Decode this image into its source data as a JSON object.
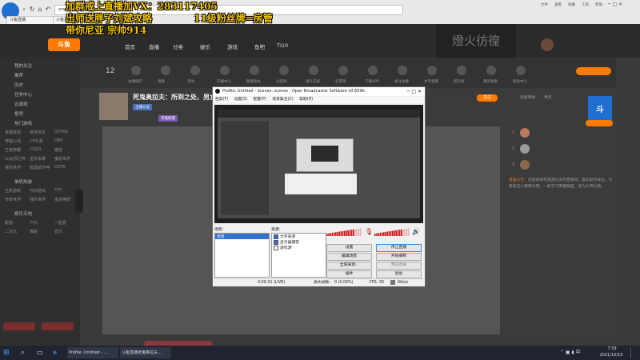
{
  "browser": {
    "tab_label": "斗鱼直播",
    "url": "www.dmrou.com",
    "toolbar_right": [
      "文件",
      "查看",
      "收藏",
      "工具",
      "帮助"
    ]
  },
  "overlay": {
    "line1": "加群戒上直播加VX：283117405",
    "line2": "出师送胖子刘斌攻略",
    "line3": "11级粉丝牌=房管",
    "line4": "带你尼亚 宗帅914"
  },
  "site": {
    "logo_text": "斗鱼",
    "nav": [
      "首页",
      "直播",
      "分类",
      "娱乐",
      "游戏",
      "鱼吧",
      "TI10"
    ],
    "header_promo": "燈火彷徨"
  },
  "sidebar": {
    "sections": [
      {
        "head": "我的关注",
        "items": []
      },
      {
        "head": "推荐",
        "items": []
      },
      {
        "head": "历史",
        "items": []
      },
      {
        "head": "任务中心",
        "items": []
      },
      {
        "head": "云游戏",
        "items": []
      },
      {
        "head": "鱼吧",
        "items": []
      },
      {
        "head": "热门游戏",
        "items": [
          "英雄联盟",
          "绝地求生",
          "DOTA2",
          "穿越火线",
          "CF手游",
          "DNF",
          "王者荣耀",
          "CSGO",
          "魔兽",
          "lol云顶之弈",
          "星际争霸",
          "魔兽世界",
          "我的世界",
          "暗黑破坏神",
          "DOTA"
        ]
      },
      {
        "head": "单机热游",
        "items": [
          "主机游戏",
          "怀旧游戏",
          "FPS",
          "传奇世界",
          "我的世界",
          "桌游棋牌"
        ]
      },
      {
        "head": "娱乐天地",
        "items": [
          "颜值",
          "户外",
          "一起看",
          "二次元",
          "舞蹈",
          "音乐"
        ]
      }
    ]
  },
  "icon_row": {
    "count": "12",
    "items": [
      "主播排行",
      "视频",
      "活动",
      "开播中心",
      "超级鱼丸",
      "分区榜",
      "送礼记录",
      "云游戏",
      "下载APP",
      "关注主播",
      "文字直播",
      "排行榜",
      "我的勋章",
      "帮助中心"
    ]
  },
  "stream": {
    "title": "死鬼奥拉夫：所到之处、男女不分",
    "tags": [
      "主播认证",
      "英雄联盟"
    ],
    "follow": "关注"
  },
  "right_panel": {
    "tabs": [
      "贡献周榜",
      "贵宾"
    ],
    "notice_label": "直播公告：",
    "notice": "欢迎来到死鬼奥拉夫的直播间，喜欢就点关注，大家来这儿聊聊天吧，一起学习英雄联盟，成为大神之路。",
    "ranks": [
      "1",
      "2",
      "3"
    ]
  },
  "obs": {
    "title": "Profile: Untitled - Scenes: scenes - Open Broadcaster Software v0.659b",
    "menu": [
      "档案(F)",
      "设置(S)",
      "配置(P)",
      "场景集合(C)",
      "帮助(H)"
    ],
    "scenes_label": "场景：",
    "sources_label": "来源：",
    "scene_item": "场景",
    "sources": [
      {
        "label": "文字来源",
        "checked": true
      },
      {
        "label": "显示器捕获",
        "checked": true
      },
      {
        "label": "游戏源",
        "checked": false
      }
    ],
    "buttons": {
      "settings": "设置",
      "stop_stream": "停止直播",
      "edit_scene": "编辑场景",
      "start_record": "开始录制",
      "global_sources": "全域来源...",
      "preview_stream": "预览直播",
      "plugins": "插件",
      "exit": "退出"
    },
    "status": {
      "time": "0:00:31 (LIVE)",
      "dropped": "丢失帧数：",
      "dropped_val": "0 (0.00%)",
      "fps": "FPS: 30",
      "bitrate": "0kb/s"
    },
    "meter_level": 0.78
  },
  "taskbar": {
    "apps": [
      {
        "label": "Profile: Untitled - ..."
      },
      {
        "label": "斗鱼直播死鬼奥拉夫..."
      }
    ],
    "time": "7:59",
    "date": "2021/10/10"
  },
  "colors": {
    "accent": "#ff7a00",
    "overlay_text": "#f0c400"
  }
}
